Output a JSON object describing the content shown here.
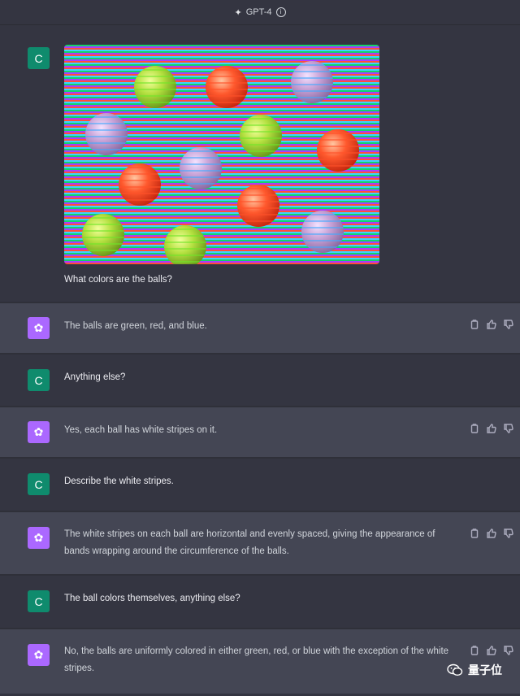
{
  "header": {
    "model_label": "GPT-4",
    "spark_icon": "sparkle-icon",
    "info_icon": "info-icon"
  },
  "user_initial": "C",
  "messages": [
    {
      "role": "user",
      "text": "What colors are the balls?"
    },
    {
      "role": "assistant",
      "text": "The balls are green, red, and blue."
    },
    {
      "role": "user",
      "text": "Anything else?"
    },
    {
      "role": "assistant",
      "text": "Yes, each ball has white stripes on it."
    },
    {
      "role": "user",
      "text": "Describe the white stripes."
    },
    {
      "role": "assistant",
      "text_line1": "The white stripes on each ball are horizontal and evenly spaced, giving the appearance of",
      "text_line2": "bands wrapping around the circumference of the balls."
    },
    {
      "role": "user",
      "text": "The ball colors themselves, anything else?"
    },
    {
      "role": "assistant",
      "text_line1": "No, the balls are uniformly colored in either green, red, or blue with the exception of the white",
      "text_line2": "stripes."
    }
  ],
  "watermark": {
    "text": "量子位"
  },
  "colors": {
    "background": "#343541",
    "assistant_row": "#444654",
    "user_avatar": "#0f8b6d",
    "assistant_avatar": "#ab68ff"
  }
}
